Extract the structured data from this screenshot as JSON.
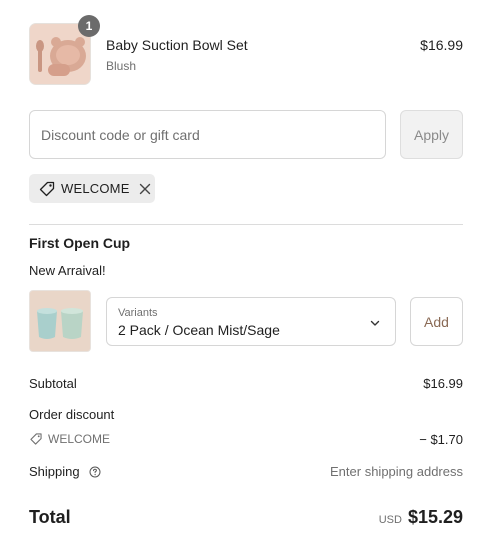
{
  "cart_item": {
    "name": "Baby Suction Bowl Set",
    "variant": "Blush",
    "price": "$16.99",
    "quantity": "1"
  },
  "discount": {
    "placeholder": "Discount code or gift card",
    "apply_label": "Apply",
    "applied_code": "WELCOME"
  },
  "upsell": {
    "title": "First Open Cup",
    "subtitle": "New Arraival!",
    "variants_label": "Variants",
    "variant_selected": "2 Pack / Ocean Mist/Sage",
    "add_label": "Add"
  },
  "summary": {
    "subtotal_label": "Subtotal",
    "subtotal_value": "$16.99",
    "order_discount_label": "Order discount",
    "discount_code": "WELCOME",
    "discount_value": "− $1.70",
    "shipping_label": "Shipping",
    "shipping_value": "Enter shipping address",
    "total_label": "Total",
    "currency": "USD",
    "total_value": "$15.29"
  },
  "colors": {
    "badge": "#6b6b6b",
    "chip_bg": "#ececec",
    "add_text": "#8a6a55"
  },
  "icons": {
    "tag": "tag-icon",
    "close": "close-icon",
    "chevron": "chevron-down-icon",
    "help": "help-circle-icon"
  }
}
